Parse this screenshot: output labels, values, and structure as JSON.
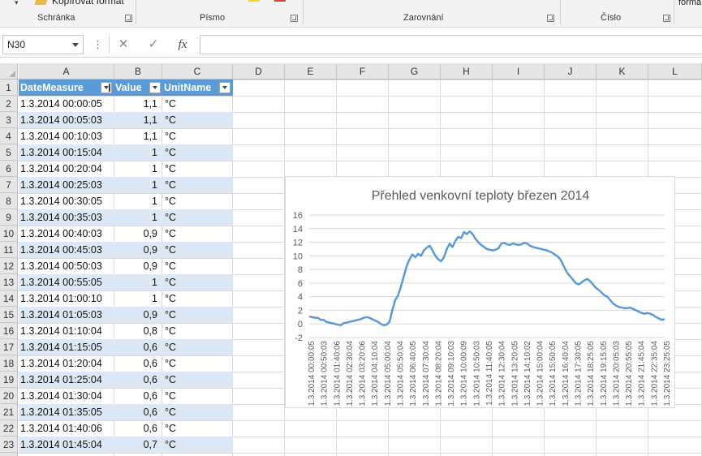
{
  "ribbon": {
    "copy_format_label": "Kopírovat formát",
    "right_text": "formá",
    "groups": [
      {
        "label": "Schránka"
      },
      {
        "label": "Písmo"
      },
      {
        "label": "Zarovnání"
      },
      {
        "label": "Číslo"
      }
    ],
    "colors": {
      "highlight": "#f5d327",
      "font_color": "#d8413a"
    }
  },
  "formula_bar": {
    "name_box": "N30",
    "dots": "⋮",
    "cancel_icon": "✕",
    "enter_icon": "✓",
    "fx_label": "fx",
    "formula": ""
  },
  "columns": [
    "A",
    "B",
    "C",
    "D",
    "E",
    "F",
    "G",
    "H",
    "I",
    "J",
    "K",
    "L"
  ],
  "table": {
    "headers": [
      "DateMeasure",
      "Value",
      "UnitName"
    ],
    "rows": [
      [
        "1.3.2014 00:00:05",
        "1,1",
        "°C"
      ],
      [
        "1.3.2014 00:05:03",
        "1,1",
        "°C"
      ],
      [
        "1.3.2014 00:10:03",
        "1,1",
        "°C"
      ],
      [
        "1.3.2014 00:15:04",
        "1",
        "°C"
      ],
      [
        "1.3.2014 00:20:04",
        "1",
        "°C"
      ],
      [
        "1.3.2014 00:25:03",
        "1",
        "°C"
      ],
      [
        "1.3.2014 00:30:05",
        "1",
        "°C"
      ],
      [
        "1.3.2014 00:35:03",
        "1",
        "°C"
      ],
      [
        "1.3.2014 00:40:03",
        "0,9",
        "°C"
      ],
      [
        "1.3.2014 00:45:03",
        "0,9",
        "°C"
      ],
      [
        "1.3.2014 00:50:03",
        "0,9",
        "°C"
      ],
      [
        "1.3.2014 00:55:05",
        "1",
        "°C"
      ],
      [
        "1.3.2014 01:00:10",
        "1",
        "°C"
      ],
      [
        "1.3.2014 01:05:03",
        "0,9",
        "°C"
      ],
      [
        "1.3.2014 01:10:04",
        "0,8",
        "°C"
      ],
      [
        "1.3.2014 01:15:05",
        "0,6",
        "°C"
      ],
      [
        "1.3.2014 01:20:04",
        "0,6",
        "°C"
      ],
      [
        "1.3.2014 01:25:04",
        "0,6",
        "°C"
      ],
      [
        "1.3.2014 01:30:04",
        "0,6",
        "°C"
      ],
      [
        "1.3.2014 01:35:05",
        "0,6",
        "°C"
      ],
      [
        "1.3.2014 01:40:06",
        "0,6",
        "°C"
      ],
      [
        "1.3.2014 01:45:04",
        "0,7",
        "°C"
      ]
    ]
  },
  "chart_data": {
    "type": "line",
    "title": "Přehled venkovní teploty březen 2014",
    "xlabel": "",
    "ylabel": "",
    "ylim": [
      -2,
      16
    ],
    "yticks": [
      -2,
      0,
      2,
      4,
      6,
      8,
      10,
      12,
      14,
      16
    ],
    "grid": true,
    "legend": "none",
    "color": "#5b9bd5",
    "x_tick_labels": [
      "1.3.2014 00:00:05",
      "1.3.2014 00:50:03",
      "1.3.2014 01:40:06",
      "1.3.2014 02:30:04",
      "1.3.2014 03:20:06",
      "1.3.2014 04:10:04",
      "1.3.2014 05:00:04",
      "1.3.2014 05:50:04",
      "1.3.2014 06:40:05",
      "1.3.2014 07:30:04",
      "1.3.2014 08:20:04",
      "1.3.2014 09:10:03",
      "1.3.2014 10:00:09",
      "1.3.2014 10:50:03",
      "1.3.2014 11:40:05",
      "1.3.2014 12:30:04",
      "1.3.2014 13:20:05",
      "1.3.2014 14:10:02",
      "1.3.2014 15:00:04",
      "1.3.2014 15:50:05",
      "1.3.2014 16:40:04",
      "1.3.2014 17:30:05",
      "1.3.2014 18:25:05",
      "1.3.2014 19:15:05",
      "1.3.2014 20:05:03",
      "1.3.2014 20:55:05",
      "1.3.2014 21:45:04",
      "1.3.2014 22:35:04",
      "1.3.2014 23:25:05"
    ],
    "series": [
      {
        "values": [
          1.1,
          1.0,
          0.9,
          0.9,
          0.6,
          0.6,
          0.3,
          0.2,
          0.1,
          0.0,
          -0.1,
          -0.2,
          0.1,
          0.2,
          0.3,
          0.4,
          0.5,
          0.6,
          0.7,
          0.9,
          1.0,
          0.9,
          0.7,
          0.5,
          0.3,
          0.0,
          -0.2,
          -0.1,
          0.3,
          2.0,
          3.5,
          4.2,
          5.5,
          7.0,
          8.5,
          9.5,
          10.2,
          9.8,
          10.3,
          10.0,
          10.8,
          11.2,
          11.5,
          10.8,
          10.0,
          9.5,
          9.2,
          9.8,
          11.0,
          11.8,
          11.3,
          12.2,
          12.8,
          12.6,
          13.5,
          13.2,
          13.6,
          13.2,
          12.5,
          12.0,
          11.6,
          11.3,
          11.0,
          10.9,
          10.8,
          10.9,
          11.1,
          11.8,
          11.9,
          11.7,
          11.6,
          11.8,
          11.7,
          11.6,
          11.7,
          11.9,
          11.8,
          11.5,
          11.3,
          11.2,
          11.1,
          11.0,
          10.9,
          10.8,
          10.6,
          10.4,
          10.1,
          9.8,
          9.2,
          8.3,
          7.5,
          7.0,
          6.5,
          6.0,
          5.8,
          6.1,
          6.4,
          6.6,
          6.3,
          5.8,
          5.3,
          5.0,
          4.6,
          4.2,
          4.0,
          3.5,
          3.0,
          2.7,
          2.5,
          2.4,
          2.3,
          2.3,
          2.4,
          2.2,
          2.0,
          1.8,
          1.6,
          1.5,
          1.6,
          1.5,
          1.3,
          1.0,
          0.8,
          0.6,
          0.7
        ]
      }
    ]
  }
}
